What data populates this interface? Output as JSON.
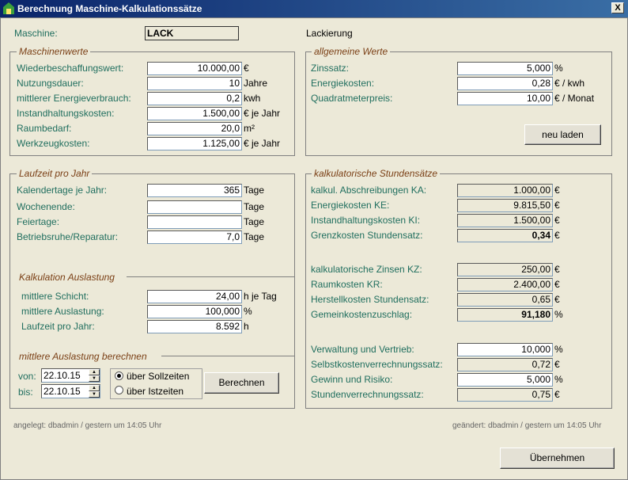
{
  "window": {
    "title": "Berechnung Maschine-Kalkulationssätze",
    "close": "X"
  },
  "machine": {
    "label": "Maschine:",
    "code": "LACK",
    "name": "Lackierung"
  },
  "maschinenwerte": {
    "title": "Maschinenwerte",
    "rows": [
      {
        "label": "Wiederbeschaffungswert:",
        "value": "10.000,00",
        "unit": "€"
      },
      {
        "label": "Nutzungsdauer:",
        "value": "10",
        "unit": "Jahre"
      },
      {
        "label": "mittlerer Energieverbrauch:",
        "value": "0,2",
        "unit": "kwh"
      },
      {
        "label": "Instandhaltungskosten:",
        "value": "1.500,00",
        "unit": "€ je Jahr"
      },
      {
        "label": "Raumbedarf:",
        "value": "20,0",
        "unit": "m²"
      },
      {
        "label": "Werkzeugkosten:",
        "value": "1.125,00",
        "unit": "€ je Jahr"
      }
    ]
  },
  "allgemein": {
    "title": "allgemeine Werte",
    "rows": [
      {
        "label": "Zinssatz:",
        "value": "5,000",
        "unit": "%"
      },
      {
        "label": "Energiekosten:",
        "value": "0,28",
        "unit": "€ / kwh"
      },
      {
        "label": "Quadratmeterpreis:",
        "value": "10,00",
        "unit": "€ / Monat"
      }
    ],
    "reload": "neu laden"
  },
  "laufzeit": {
    "title": "Laufzeit pro Jahr",
    "rows": [
      {
        "label": "Kalendertage je Jahr:",
        "value": "365",
        "unit": "Tage"
      },
      {
        "label": "Wochenende:",
        "value": "",
        "unit": "Tage"
      },
      {
        "label": "Feiertage:",
        "value": "",
        "unit": "Tage"
      },
      {
        "label": "Betriebsruhe/Reparatur:",
        "value": "7,0",
        "unit": "Tage"
      }
    ]
  },
  "auslastung": {
    "title": "Kalkulation Auslastung",
    "rows": [
      {
        "label": "mittlere Schicht:",
        "value": "24,00",
        "unit": "h je Tag"
      },
      {
        "label": "mittlere Auslastung:",
        "value": "100,000",
        "unit": "%"
      },
      {
        "label": "Laufzeit pro Jahr:",
        "value": "8.592",
        "unit": "h"
      }
    ]
  },
  "berechnen": {
    "title": "mittlere Auslastung berechnen",
    "von_label": "von:",
    "von_value": "22.10.15",
    "bis_label": "bis:",
    "bis_value": "22.10.15",
    "radio_soll": "über Sollzeiten",
    "radio_ist": "über Istzeiten",
    "button": "Berechnen"
  },
  "stundensaetze": {
    "title": "kalkulatorische Stundensätze",
    "rows": [
      {
        "label": "kalkul. Abschreibungen KA:",
        "value": "1.000,00",
        "unit": "€"
      },
      {
        "label": "Energiekosten KE:",
        "value": "9.815,50",
        "unit": "€"
      },
      {
        "label": "Instandhaltungskosten KI:",
        "value": "1.500,00",
        "unit": "€"
      },
      {
        "label": "Grenzkosten Stundensatz:",
        "value": "0,34",
        "unit": "€"
      },
      {
        "label": "kalkulatorische Zinsen KZ:",
        "value": "250,00",
        "unit": "€"
      },
      {
        "label": "Raumkosten KR:",
        "value": "2.400,00",
        "unit": "€"
      },
      {
        "label": "Herstellkosten Stundensatz:",
        "value": "0,65",
        "unit": "€"
      },
      {
        "label": "Gemeinkostenzuschlag:",
        "value": "91,180",
        "unit": "%"
      },
      {
        "label": "Verwaltung und Vertrieb:",
        "value": "10,000",
        "unit": "%"
      },
      {
        "label": "Selbstkostenverrechnungssatz:",
        "value": "0,72",
        "unit": "€"
      },
      {
        "label": "Gewinn und Risiko:",
        "value": "5,000",
        "unit": "%"
      },
      {
        "label": "Stundenverrechnungssatz:",
        "value": "0,75",
        "unit": "€"
      }
    ]
  },
  "footer": {
    "created": "angelegt: dbadmin / gestern um 14:05 Uhr",
    "changed": "geändert: dbadmin / gestern um 14:05 Uhr",
    "apply": "Übernehmen"
  }
}
